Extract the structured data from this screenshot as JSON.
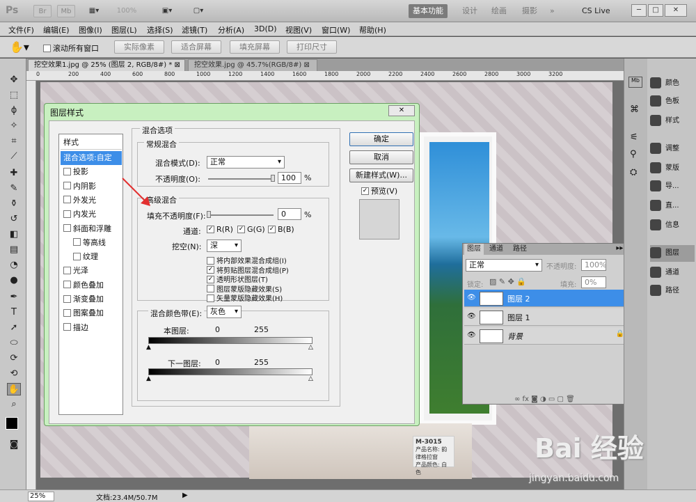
{
  "app": {
    "logo": "Ps",
    "zoom_display": "100%",
    "workspaces": [
      "基本功能",
      "设计",
      "绘画",
      "摄影",
      "»"
    ],
    "cs_live": "CS Live"
  },
  "menu": [
    "文件(F)",
    "编辑(E)",
    "图像(I)",
    "图层(L)",
    "选择(S)",
    "滤镜(T)",
    "分析(A)",
    "3D(D)",
    "视图(V)",
    "窗口(W)",
    "帮助(H)"
  ],
  "options": {
    "scroll_all": "滚动所有窗口",
    "buttons": [
      "实际像素",
      "适合屏幕",
      "填充屏幕",
      "打印尺寸"
    ]
  },
  "tabs": [
    {
      "label": "挖空效果1.jpg @ 25% (图层 2, RGB/8#) *"
    },
    {
      "label": "挖空效果.jpg @ 45.7%(RGB/8#)"
    }
  ],
  "ruler": [
    "0",
    "200",
    "400",
    "600",
    "800",
    "1000",
    "1200",
    "1400",
    "1600",
    "1800",
    "2000",
    "2200",
    "2400",
    "2600",
    "2800",
    "3000",
    "3200"
  ],
  "status": {
    "zoom": "25%",
    "doc": "文档:23.4M/50.7M"
  },
  "right_panel": {
    "items": [
      "颜色",
      "色板",
      "样式",
      "调整",
      "蒙版",
      "导...",
      "直...",
      "信息",
      "图层",
      "通道",
      "路径"
    ]
  },
  "layers": {
    "tabs": [
      "图层",
      "通道",
      "路径"
    ],
    "blend": "正常",
    "opacity_label": "不透明度:",
    "opacity": "100%",
    "lock_label": "锁定:",
    "fill_label": "填充:",
    "fill": "0%",
    "rows": [
      {
        "name": "图层 2",
        "selected": true
      },
      {
        "name": "图层 1",
        "selected": false
      },
      {
        "name": "背景",
        "selected": false
      }
    ]
  },
  "dialog": {
    "title": "图层样式",
    "styles_header": "样式",
    "styles": [
      {
        "label": "混合选项:自定",
        "selected": true,
        "check": false,
        "indent": false
      },
      {
        "label": "投影",
        "check": true
      },
      {
        "label": "内阴影",
        "check": true
      },
      {
        "label": "外发光",
        "check": true
      },
      {
        "label": "内发光",
        "check": true
      },
      {
        "label": "斜面和浮雕",
        "check": true
      },
      {
        "label": "等高线",
        "check": true,
        "indent": true
      },
      {
        "label": "纹理",
        "check": true,
        "indent": true
      },
      {
        "label": "光泽",
        "check": true
      },
      {
        "label": "颜色叠加",
        "check": true
      },
      {
        "label": "渐变叠加",
        "check": true
      },
      {
        "label": "图案叠加",
        "check": true
      },
      {
        "label": "描边",
        "check": true
      }
    ],
    "blend_options_title": "混合选项",
    "general_title": "常规混合",
    "blend_mode_label": "混合模式(D):",
    "blend_mode": "正常",
    "opacity_label": "不透明度(O):",
    "opacity": "100",
    "pct": "%",
    "advanced_title": "高级混合",
    "fill_label": "填充不透明度(F):",
    "fill": "0",
    "channels_label": "通道:",
    "channels": [
      "R(R)",
      "G(G)",
      "B(B)"
    ],
    "knockout_label": "挖空(N):",
    "knockout": "深",
    "options": [
      {
        "label": "将内部效果混合成组(I)",
        "checked": false
      },
      {
        "label": "将剪贴图层混合成组(P)",
        "checked": true
      },
      {
        "label": "透明形状图层(T)",
        "checked": true
      },
      {
        "label": "图层蒙版隐藏效果(S)",
        "checked": false
      },
      {
        "label": "矢量蒙版隐藏效果(H)",
        "checked": false
      }
    ],
    "blend_if_label": "混合颜色带(E):",
    "blend_if": "灰色",
    "this_layer": "本图层:",
    "underlying": "下一图层:",
    "low": "0",
    "high": "255",
    "ok": "确定",
    "cancel": "取消",
    "new_style": "新建样式(W)...",
    "preview": "预览(V)"
  },
  "photo_sign": {
    "code": "M-3015",
    "line1": "产品名称: 韵律格拉窗",
    "line2": "产品颜色: 白色"
  },
  "watermark": {
    "main": "Bai 经验",
    "sub": "jingyan.baidu.com"
  }
}
